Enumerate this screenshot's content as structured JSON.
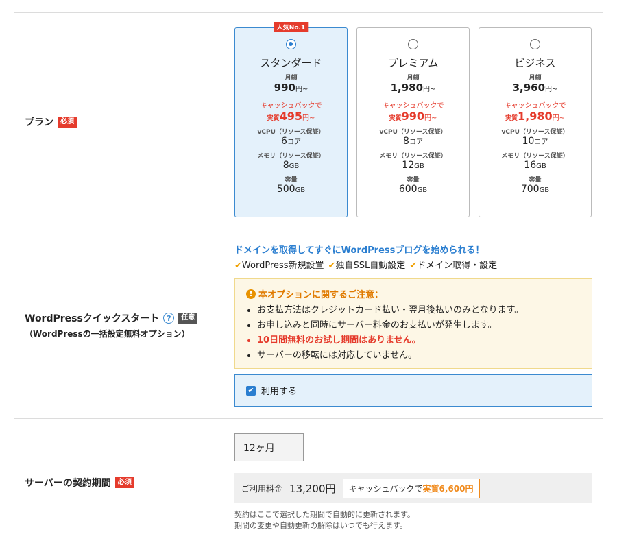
{
  "plan_row": {
    "label": "プラン",
    "required": "必須",
    "plans": [
      {
        "name": "スタンダード",
        "selected": true,
        "badge": "人気No.1",
        "monthly_label": "月額",
        "price": "990",
        "price_unit": "円~",
        "cashback_label": "キャッシュバックで",
        "real_label": "実質",
        "real_price": "495",
        "real_unit": "円~",
        "vcpu_label": "vCPU（リソース保証）",
        "vcpu": "6",
        "vcpu_unit": "コア",
        "memory_label": "メモリ（リソース保証）",
        "memory": "8",
        "memory_unit": "GB",
        "storage_label": "容量",
        "storage": "500",
        "storage_unit": "GB"
      },
      {
        "name": "プレミアム",
        "selected": false,
        "badge": "",
        "monthly_label": "月額",
        "price": "1,980",
        "price_unit": "円~",
        "cashback_label": "キャッシュバックで",
        "real_label": "実質",
        "real_price": "990",
        "real_unit": "円~",
        "vcpu_label": "vCPU（リソース保証）",
        "vcpu": "8",
        "vcpu_unit": "コア",
        "memory_label": "メモリ（リソース保証）",
        "memory": "12",
        "memory_unit": "GB",
        "storage_label": "容量",
        "storage": "600",
        "storage_unit": "GB"
      },
      {
        "name": "ビジネス",
        "selected": false,
        "badge": "",
        "monthly_label": "月額",
        "price": "3,960",
        "price_unit": "円~",
        "cashback_label": "キャッシュバックで",
        "real_label": "実質",
        "real_price": "1,980",
        "real_unit": "円~",
        "vcpu_label": "vCPU（リソース保証）",
        "vcpu": "10",
        "vcpu_unit": "コア",
        "memory_label": "メモリ（リソース保証）",
        "memory": "16",
        "memory_unit": "GB",
        "storage_label": "容量",
        "storage": "700",
        "storage_unit": "GB"
      }
    ]
  },
  "wp_row": {
    "label": "WordPressクイックスタート",
    "help": "?",
    "optional": "任意",
    "sublabel": "（WordPressの一括設定無料オプション）",
    "headline": "ドメインを取得してすぐにWordPressブログを始められる！",
    "features": [
      "WordPress新規設置",
      "独自SSL自動設定",
      "ドメイン取得・設定"
    ],
    "notice_title": "本オプションに関するご注意：",
    "notice_items": [
      "お支払方法はクレジットカード払い・翌月後払いのみとなります。",
      "お申し込みと同時にサーバー料金のお支払いが発生します。",
      "10日間無料のお試し期間はありません。",
      "サーバーの移転には対応していません。"
    ],
    "use_label": "利用する"
  },
  "period_row": {
    "label": "サーバーの契約期間",
    "required": "必須",
    "period": "12ヶ月",
    "fee_label": "ご利用料金",
    "fee_value": "13,200円",
    "cashback_text": "キャッシュバックで",
    "cashback_value": "実質6,600円",
    "note1": "契約はここで選択した期間で自動的に更新されます。",
    "note2": "期間の変更や自動更新の解除はいつでも行えます。"
  },
  "colors": {
    "accent": "#2a7ed0",
    "required": "#e53b2c",
    "cashback": "#f08a1c"
  }
}
